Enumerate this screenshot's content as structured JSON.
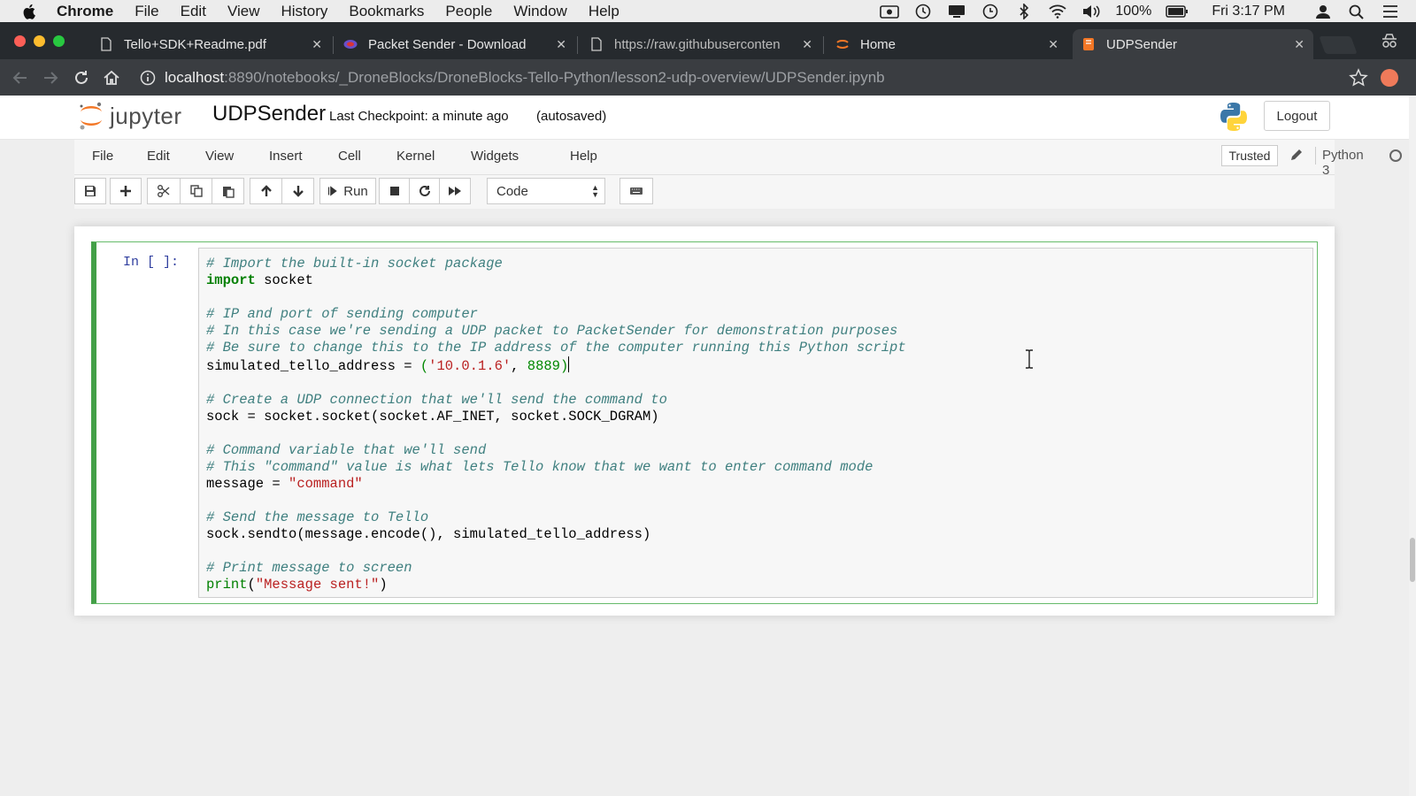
{
  "menubar": {
    "items": [
      "Chrome",
      "File",
      "Edit",
      "View",
      "History",
      "Bookmarks",
      "People",
      "Window",
      "Help"
    ],
    "battery": "100%",
    "clock": "Fri 3:17 PM"
  },
  "tabs": [
    {
      "title": "Tello+SDK+Readme.pdf",
      "icon": "document-icon"
    },
    {
      "title": "Packet Sender - Download",
      "icon": "packet-sender-icon"
    },
    {
      "title": "https://raw.githubuserconten",
      "icon": "document-icon"
    },
    {
      "title": "Home",
      "icon": "jupyter-icon"
    },
    {
      "title": "UDPSender",
      "icon": "notebook-icon",
      "active": true
    }
  ],
  "address": {
    "host": "localhost",
    "path": ":8890/notebooks/_DroneBlocks/DroneBlocks-Tello-Python/lesson2-udp-overview/UDPSender.ipynb"
  },
  "jupyter": {
    "logo_text": "jupyter",
    "notebook_name": "UDPSender",
    "checkpoint": "Last Checkpoint: a minute ago",
    "autosave": "(autosaved)",
    "logout": "Logout",
    "menu": [
      "File",
      "Edit",
      "View",
      "Insert",
      "Cell",
      "Kernel",
      "Widgets",
      "Help"
    ],
    "trusted": "Trusted",
    "kernel": "Python 3",
    "run_label": "Run",
    "cell_type": "Code"
  },
  "cell": {
    "prompt": "In [ ]:",
    "lines": {
      "l1": "# Import the built-in socket package",
      "l2_kw": "import",
      "l2_rest": " socket",
      "l4": "# IP and port of sending computer",
      "l5": "# In this case we're sending a UDP packet to PacketSender for demonstration purposes",
      "l6": "# Be sure to change this to the IP address of the computer running this Python script",
      "l7_a": "simulated_tello_address = ",
      "l7_b": "(",
      "l7_c": "'10.0.1.6'",
      "l7_d": ", ",
      "l7_e": "8889",
      "l7_f": ")",
      "l9": "# Create a UDP connection that we'll send the command to",
      "l10": "sock = socket.socket(socket.AF_INET, socket.SOCK_DGRAM)",
      "l12": "# Command variable that we'll send",
      "l13": "# This \"command\" value is what lets Tello know that we want to enter command mode",
      "l14_a": "message = ",
      "l14_b": "\"command\"",
      "l16": "# Send the message to Tello",
      "l17": "sock.sendto(message.encode(), simulated_tello_address)",
      "l19": "# Print message to screen",
      "l20_a": "print",
      "l20_b": "(",
      "l20_c": "\"Message sent!\"",
      "l20_d": ")"
    }
  }
}
